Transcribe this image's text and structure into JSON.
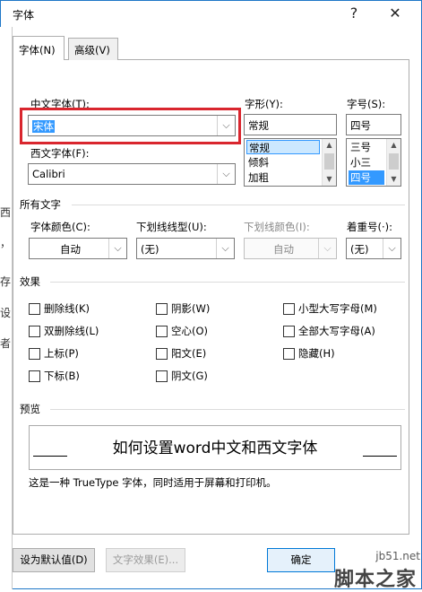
{
  "window": {
    "title": "字体",
    "help_icon": "?",
    "close_icon": "✕"
  },
  "background_text": [
    "西",
    "，",
    "存",
    "设",
    "者"
  ],
  "tabs": [
    {
      "label": "字体(N)",
      "active": true
    },
    {
      "label": "高级(V)",
      "active": false
    }
  ],
  "font_section": {
    "chinese_font_label": "中文字体(T):",
    "chinese_font_value": "宋体",
    "western_font_label": "西文字体(F):",
    "western_font_value": "Calibri",
    "style_label": "字形(Y):",
    "style_value": "常规",
    "style_options": [
      "常规",
      "倾斜",
      "加粗"
    ],
    "size_label": "字号(S):",
    "size_value": "四号",
    "size_options": [
      "三号",
      "小三",
      "四号"
    ]
  },
  "all_text": {
    "heading": "所有文字",
    "font_color_label": "字体颜色(C):",
    "font_color_value": "自动",
    "underline_style_label": "下划线线型(U):",
    "underline_style_value": "(无)",
    "underline_color_label": "下划线颜色(I):",
    "underline_color_value": "自动",
    "emphasis_label": "着重号(·):",
    "emphasis_value": "(无)"
  },
  "effects": {
    "heading": "效果",
    "items": [
      {
        "label": "删除线(K)",
        "checked": false
      },
      {
        "label": "阴影(W)",
        "checked": false
      },
      {
        "label": "小型大写字母(M)",
        "checked": false
      },
      {
        "label": "双删除线(L)",
        "checked": false
      },
      {
        "label": "空心(O)",
        "checked": false
      },
      {
        "label": "全部大写字母(A)",
        "checked": false
      },
      {
        "label": "上标(P)",
        "checked": false
      },
      {
        "label": "阳文(E)",
        "checked": false
      },
      {
        "label": "隐藏(H)",
        "checked": false
      },
      {
        "label": "下标(B)",
        "checked": false
      },
      {
        "label": "阴文(G)",
        "checked": false
      }
    ]
  },
  "preview": {
    "heading": "预览",
    "sample_text": "如何设置word中文和西文字体",
    "note": "这是一种 TrueType 字体，同时适用于屏幕和打印机。"
  },
  "buttons": {
    "set_default": "设为默认值(D)",
    "text_effects": "文字效果(E)...",
    "ok": "确定"
  },
  "watermark": {
    "site": "jb51.net",
    "brand": "脚本之家"
  },
  "colors": {
    "highlight": "#3399ff",
    "red_box": "#d9262e",
    "window_border": "#1e77c7"
  }
}
